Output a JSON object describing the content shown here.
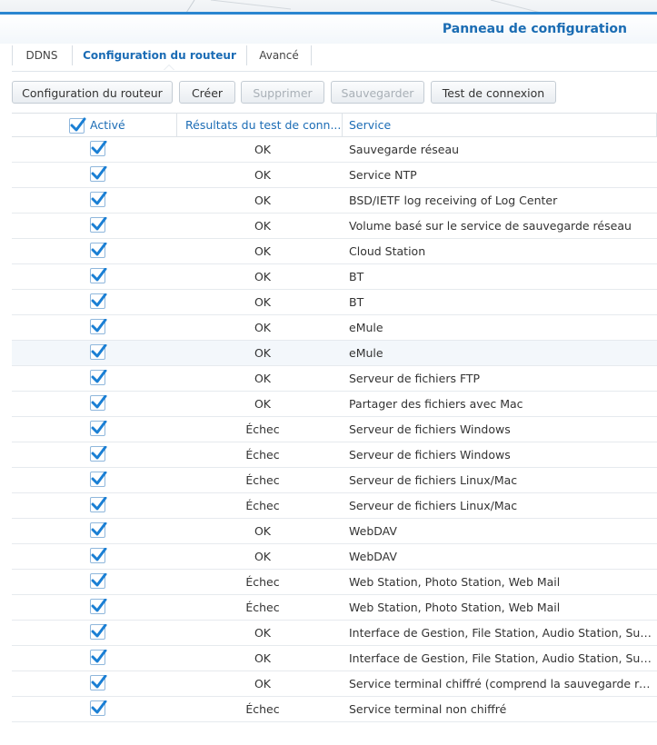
{
  "window": {
    "title": "Panneau de configuration"
  },
  "tabs": [
    {
      "label": "DDNS"
    },
    {
      "label": "Configuration du routeur"
    },
    {
      "label": "Avancé"
    }
  ],
  "toolbar": {
    "router_config_label": "Configuration du routeur",
    "create_label": "Créer",
    "delete_label": "Supprimer",
    "save_label": "Sauvegarder",
    "test_label": "Test de connexion"
  },
  "columns": {
    "enabled": "Activé",
    "result": "Résultats du test de conn...",
    "service": "Service"
  },
  "rows": [
    {
      "enabled": true,
      "result": "OK",
      "service": "Sauvegarde réseau"
    },
    {
      "enabled": true,
      "result": "OK",
      "service": "Service NTP"
    },
    {
      "enabled": true,
      "result": "OK",
      "service": "BSD/IETF log receiving of Log Center"
    },
    {
      "enabled": true,
      "result": "OK",
      "service": "Volume basé sur le service de sauvegarde réseau"
    },
    {
      "enabled": true,
      "result": "OK",
      "service": "Cloud Station"
    },
    {
      "enabled": true,
      "result": "OK",
      "service": "BT"
    },
    {
      "enabled": true,
      "result": "OK",
      "service": "BT"
    },
    {
      "enabled": true,
      "result": "OK",
      "service": "eMule"
    },
    {
      "enabled": true,
      "result": "OK",
      "service": "eMule"
    },
    {
      "enabled": true,
      "result": "OK",
      "service": "Serveur de fichiers FTP"
    },
    {
      "enabled": true,
      "result": "OK",
      "service": "Partager des fichiers avec Mac"
    },
    {
      "enabled": true,
      "result": "Échec",
      "service": "Serveur de fichiers Windows"
    },
    {
      "enabled": true,
      "result": "Échec",
      "service": "Serveur de fichiers Windows"
    },
    {
      "enabled": true,
      "result": "Échec",
      "service": "Serveur de fichiers Linux/Mac"
    },
    {
      "enabled": true,
      "result": "Échec",
      "service": "Serveur de fichiers Linux/Mac"
    },
    {
      "enabled": true,
      "result": "OK",
      "service": "WebDAV"
    },
    {
      "enabled": true,
      "result": "OK",
      "service": "WebDAV"
    },
    {
      "enabled": true,
      "result": "Échec",
      "service": "Web Station, Photo Station, Web Mail"
    },
    {
      "enabled": true,
      "result": "Échec",
      "service": "Web Station, Photo Station, Web Mail"
    },
    {
      "enabled": true,
      "result": "OK",
      "service": "Interface de Gestion, File Station, Audio Station, Surv..."
    },
    {
      "enabled": true,
      "result": "OK",
      "service": "Interface de Gestion, File Station, Audio Station, Surv..."
    },
    {
      "enabled": true,
      "result": "OK",
      "service": "Service terminal chiffré (comprend la sauvegarde rése..."
    },
    {
      "enabled": true,
      "result": "Échec",
      "service": "Service terminal non chiffré"
    }
  ],
  "highlighted_row": 8,
  "colors": {
    "accent": "#1b6cb5",
    "check": "#1a7fd4"
  },
  "icons": {
    "check": "checkmark-icon"
  }
}
